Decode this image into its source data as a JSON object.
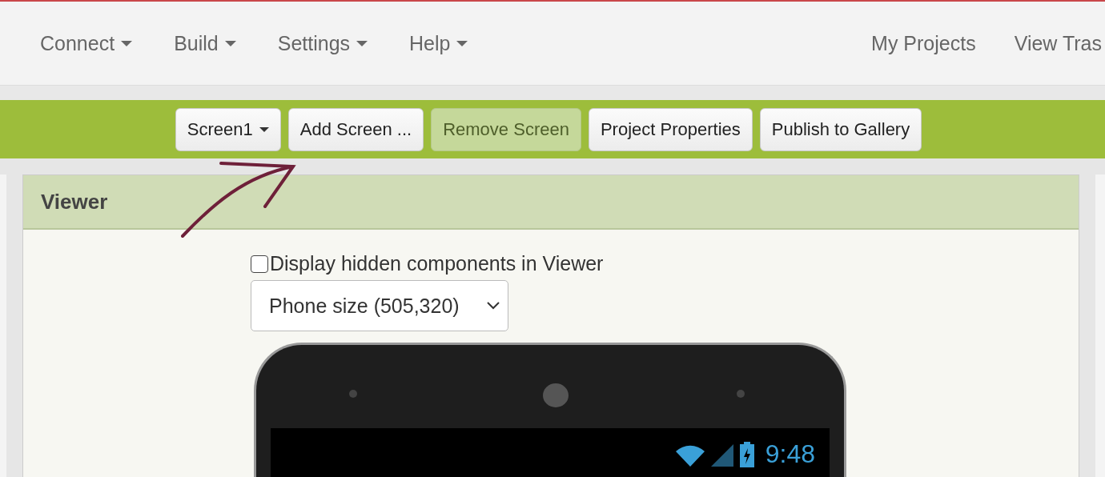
{
  "top_menu": [
    {
      "label": "Connect"
    },
    {
      "label": "Build"
    },
    {
      "label": "Settings"
    },
    {
      "label": "Help"
    }
  ],
  "top_links": [
    {
      "label": "My Projects"
    },
    {
      "label": "View Tras"
    }
  ],
  "toolbar": [
    {
      "label": "Screen1",
      "kind": "dropdown",
      "disabled": false
    },
    {
      "label": "Add Screen ...",
      "kind": "button",
      "disabled": false
    },
    {
      "label": "Remove Screen",
      "kind": "button",
      "disabled": true
    },
    {
      "label": "Project Properties",
      "kind": "button",
      "disabled": false
    },
    {
      "label": "Publish to Gallery",
      "kind": "button",
      "disabled": false
    }
  ],
  "viewer": {
    "title": "Viewer",
    "hidden_checkbox": {
      "label": "Display hidden components in Viewer",
      "checked": false
    },
    "size_select": {
      "value": "Phone size (505,320)"
    },
    "phone": {
      "time": "9:48"
    }
  }
}
